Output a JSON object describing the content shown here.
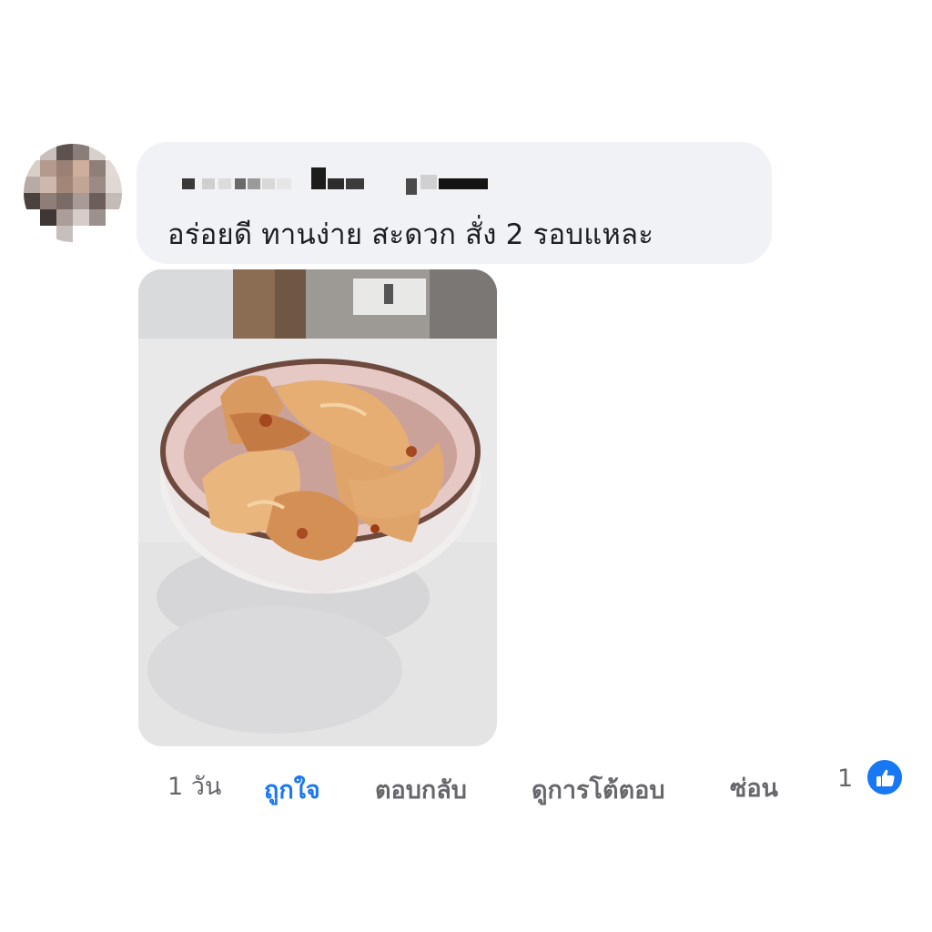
{
  "comment": {
    "author_blurred": true,
    "text": "อร่อยดี ทานง่าย สะดวก สั่ง 2 รอบแหละ",
    "has_photo": true
  },
  "actions": {
    "time": "1 วัน",
    "like": "ถูกใจ",
    "reply": "ตอบกลับ",
    "view_replies": "ดูการโต้ตอบ",
    "hide": "ซ่อน"
  },
  "reactions": {
    "count": "1",
    "icon": "like-thumb-icon"
  },
  "colors": {
    "bubble_bg": "#f0f2f5",
    "accent": "#1877f2",
    "secondary_text": "#65676b",
    "primary_text": "#1c1e21"
  }
}
